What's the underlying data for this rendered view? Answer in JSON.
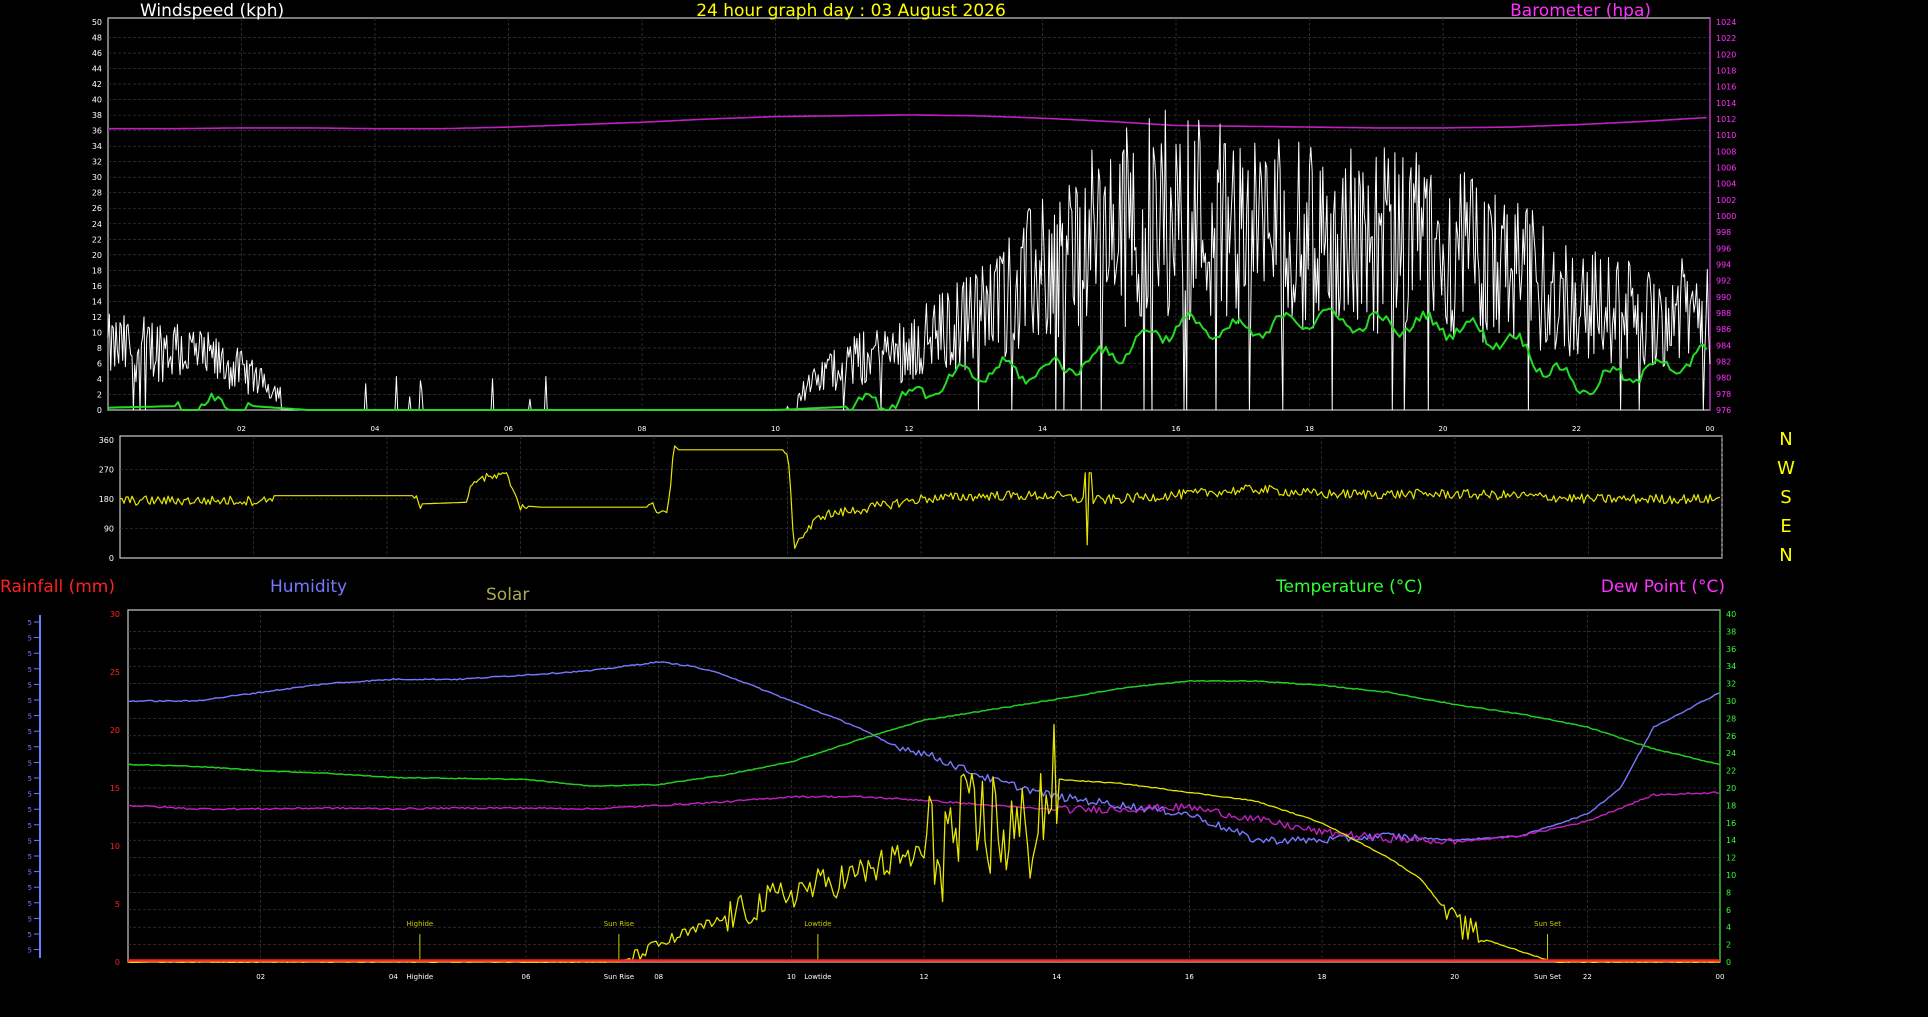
{
  "header": {
    "title": "24 hour graph day : 03 August 2026",
    "windspeed_label": "Windspeed (kph)",
    "barometer_label": "Barometer (hpa)"
  },
  "compass": [
    "N",
    "W",
    "S",
    "E",
    "N"
  ],
  "lower_header": {
    "rainfall_label": "Rainfall (mm)",
    "humidity_label": "Humidity",
    "solar_label": "Solar",
    "temperature_label": "Temperature (°C)",
    "dewpoint_label": "Dew Point (°C)"
  },
  "colors": {
    "background": "#000000",
    "windspeed": "#ffffff",
    "wind_average": "#22dd22",
    "barometer": "#c020c0",
    "barometer_text": "#ff33ff",
    "direction": "#e6e600",
    "title": "#ffff00",
    "rainfall": "#ff2020",
    "humidity": "#7777ff",
    "solar": "#e6e600",
    "solar_label": "#aaaa55",
    "temperature": "#22cc22",
    "temperature_text": "#33ff33",
    "dewpoint": "#c020c0",
    "grid": "#444444"
  },
  "chart_data": [
    {
      "id": "wind",
      "type": "line",
      "xlim": [
        0,
        24
      ],
      "x_ticks": [
        "02",
        "04",
        "06",
        "08",
        "10",
        "12",
        "14",
        "16",
        "18",
        "20",
        "22",
        "00"
      ],
      "y_left": {
        "label": "Windspeed (kph)",
        "ylim": [
          0,
          50
        ],
        "ticks": [
          0,
          2,
          4,
          6,
          8,
          10,
          12,
          14,
          16,
          18,
          20,
          22,
          24,
          26,
          28,
          30,
          32,
          34,
          36,
          38,
          40,
          42,
          44,
          46,
          48,
          50
        ]
      },
      "y_right": {
        "label": "Barometer (hpa)",
        "ylim": [
          976,
          1024
        ],
        "ticks": [
          976,
          978,
          980,
          982,
          984,
          986,
          988,
          990,
          992,
          994,
          996,
          998,
          1000,
          1002,
          1004,
          1006,
          1008,
          1010,
          1012,
          1014,
          1016,
          1018,
          1020,
          1022,
          1024
        ]
      },
      "series": [
        {
          "key": "barometer",
          "axis": "right",
          "x": [
            0,
            1,
            2,
            3,
            4,
            5,
            6,
            7,
            8,
            9,
            10,
            11,
            12,
            13,
            14,
            15,
            16,
            17,
            18,
            19,
            20,
            21,
            22,
            23,
            24
          ],
          "values": [
            1010.8,
            1010.8,
            1010.9,
            1010.9,
            1010.8,
            1010.8,
            1011.0,
            1011.3,
            1011.6,
            1012.0,
            1012.3,
            1012.4,
            1012.5,
            1012.4,
            1012.1,
            1011.7,
            1011.2,
            1011.1,
            1011.0,
            1010.9,
            1010.9,
            1011.0,
            1011.3,
            1011.7,
            1012.2
          ]
        },
        {
          "key": "wind_gust_envelope",
          "axis": "left",
          "x": [
            0,
            1,
            2,
            3,
            4,
            5,
            6,
            7,
            8,
            9,
            10,
            11,
            12,
            13,
            14,
            15,
            16,
            17,
            18,
            19,
            20,
            21,
            22,
            23,
            24
          ],
          "values": [
            8,
            8,
            5,
            0,
            2,
            0,
            1,
            0,
            1,
            0,
            0,
            6,
            8,
            12,
            18,
            23,
            26,
            24,
            22,
            22,
            21,
            18,
            14,
            12,
            13
          ]
        },
        {
          "key": "wind_average",
          "axis": "left",
          "x": [
            0,
            1,
            2,
            3,
            4,
            5,
            6,
            7,
            8,
            9,
            10,
            11,
            12,
            13,
            14,
            15,
            16,
            17,
            18,
            19,
            20,
            21,
            22,
            23,
            24
          ],
          "values": [
            0.3,
            0.5,
            0.6,
            0,
            0,
            0,
            0,
            0,
            0,
            0,
            0,
            0.4,
            1.5,
            5,
            5,
            7,
            11,
            10,
            12,
            11,
            11,
            9,
            3,
            5,
            7
          ]
        }
      ]
    },
    {
      "id": "direction",
      "type": "line",
      "xlim": [
        0,
        24
      ],
      "ylim": [
        0,
        360
      ],
      "y_ticks": [
        0,
        90,
        180,
        270,
        360
      ],
      "series": [
        {
          "key": "direction",
          "x": [
            0,
            2.2,
            2.3,
            4.4,
            4.5,
            5.2,
            5.3,
            5.8,
            6.0,
            6.3,
            7.0,
            8.0,
            8.2,
            8.3,
            10.0,
            10.1,
            10.5,
            11,
            12,
            13,
            14,
            14.5,
            15,
            16,
            17,
            18,
            19,
            20,
            21,
            22,
            23,
            24
          ],
          "values": [
            175,
            175,
            190,
            190,
            165,
            170,
            240,
            250,
            160,
            155,
            155,
            155,
            135,
            330,
            330,
            40,
            130,
            145,
            180,
            190,
            190,
            175,
            180,
            195,
            210,
            195,
            195,
            195,
            190,
            180,
            180,
            180
          ]
        }
      ]
    },
    {
      "id": "lower",
      "type": "line",
      "xlim": [
        0,
        24
      ],
      "x_ticks": [
        "02",
        "04",
        "06",
        "08",
        "10",
        "12",
        "14",
        "16",
        "18",
        "20",
        "22",
        "00"
      ],
      "y_left": {
        "label": "Rainfall (mm)",
        "ylim": [
          0,
          30
        ],
        "ticks": [
          0,
          5,
          10,
          15,
          20,
          25,
          30
        ]
      },
      "y_right": {
        "label": "Temperature (°C)",
        "ylim": [
          0,
          40
        ],
        "ticks": [
          0,
          2,
          4,
          6,
          8,
          10,
          12,
          14,
          16,
          18,
          20,
          22,
          24,
          26,
          28,
          30,
          32,
          34,
          36,
          38,
          40
        ]
      },
      "events": [
        {
          "x": 4.4,
          "label": "Highide"
        },
        {
          "x": 7.4,
          "label": "Sun Rise"
        },
        {
          "x": 10.4,
          "label": "Lowtide"
        },
        {
          "x": 21.4,
          "label": "Sun Set"
        }
      ],
      "series": [
        {
          "key": "humidity",
          "axis": "right",
          "x": [
            0,
            1,
            2,
            3,
            4,
            5,
            6,
            7,
            8,
            8.5,
            9,
            10,
            11,
            11.5,
            12,
            13,
            14,
            15,
            16,
            17,
            18,
            19,
            20,
            21,
            22,
            22.5,
            23,
            24
          ],
          "values": [
            30,
            30,
            31,
            32,
            32.5,
            32.5,
            33,
            33.5,
            34.5,
            34,
            33,
            30,
            27,
            25,
            24,
            21,
            19,
            18,
            17,
            14,
            14,
            14.5,
            14,
            14.5,
            17,
            20,
            27,
            31
          ]
        },
        {
          "key": "temperature",
          "axis": "right",
          "x": [
            0,
            1,
            2,
            3,
            4,
            5,
            6,
            7,
            8,
            9,
            10,
            11,
            12,
            13,
            14,
            15,
            16,
            17,
            18,
            19,
            20,
            21,
            22,
            23,
            24
          ],
          "values": [
            22.7,
            22.5,
            22.0,
            21.7,
            21.2,
            21.1,
            21.0,
            20.2,
            20.4,
            21.5,
            23.0,
            25.5,
            27.8,
            29.0,
            30.2,
            31.5,
            32.3,
            32.3,
            31.8,
            31.0,
            29.6,
            28.5,
            27.0,
            24.5,
            22.7
          ]
        },
        {
          "key": "dewpoint",
          "axis": "right",
          "x": [
            0,
            1,
            2,
            3,
            4,
            5,
            6,
            7,
            8,
            9,
            10,
            11,
            12,
            13,
            14,
            15,
            16,
            17,
            18,
            19,
            20,
            21,
            22,
            23,
            24
          ],
          "values": [
            18.0,
            17.6,
            17.6,
            17.7,
            17.6,
            17.7,
            17.7,
            17.6,
            18.0,
            18.4,
            19.0,
            19.0,
            18.6,
            18.0,
            17.5,
            17.6,
            17.8,
            16.4,
            14.9,
            14.2,
            13.8,
            14.5,
            16.2,
            19.2,
            19.5
          ]
        },
        {
          "key": "solar",
          "axis": "right",
          "x": [
            0,
            7.4,
            7.6,
            8,
            8.5,
            9,
            9.5,
            10,
            10.5,
            11,
            11.5,
            12,
            12.5,
            13,
            13.5,
            14,
            15,
            16,
            17,
            18,
            19,
            19.5,
            20,
            20.5,
            21,
            21.5,
            24
          ],
          "values": [
            0,
            0,
            0.5,
            2,
            3.5,
            5,
            6.5,
            8,
            9,
            10,
            11.5,
            12.5,
            14.5,
            16,
            14,
            21,
            20.5,
            19.5,
            18.5,
            16,
            12,
            9.5,
            4.5,
            2.5,
            1.2,
            0,
            0
          ]
        },
        {
          "key": "rainfall",
          "axis": "left",
          "x": [
            0,
            24
          ],
          "values": [
            0,
            0
          ]
        }
      ]
    }
  ]
}
